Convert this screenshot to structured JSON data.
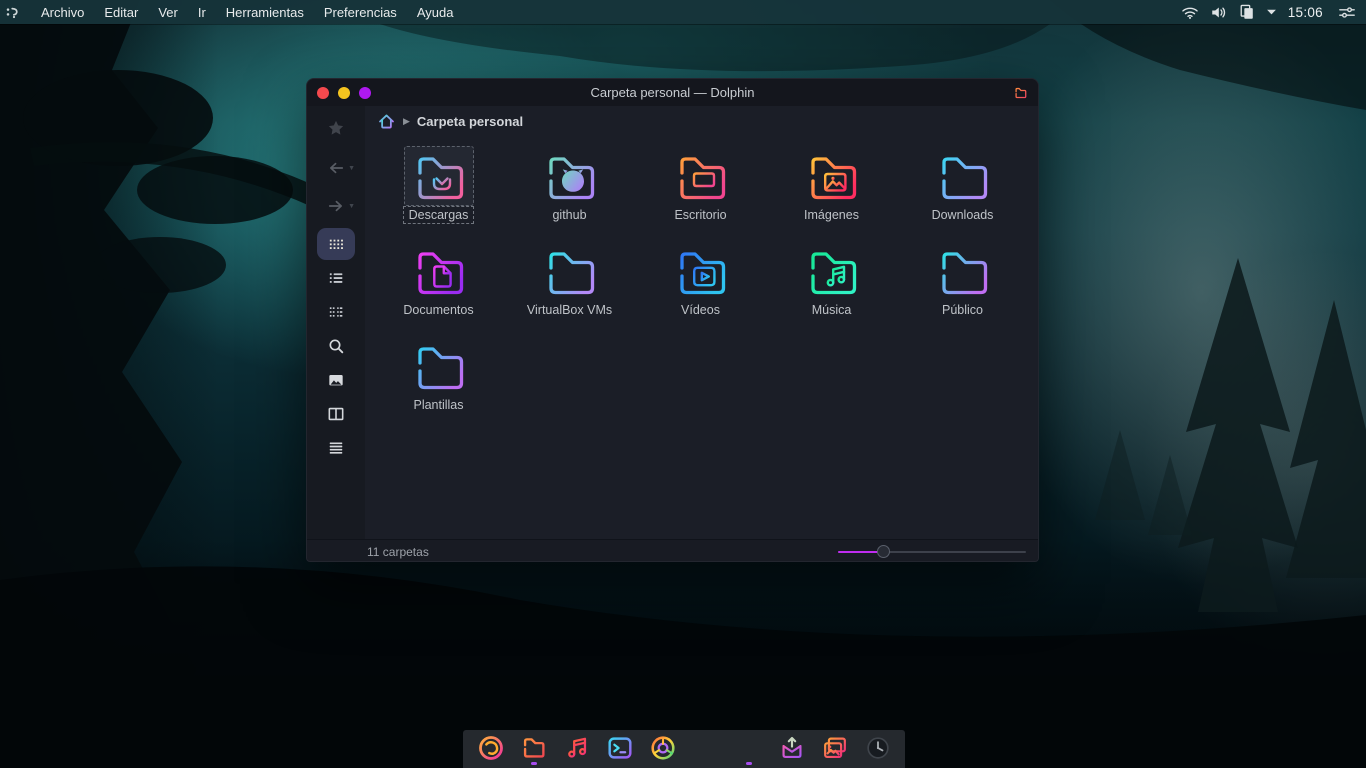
{
  "menubar": {
    "logo_icon": "distro-logo-icon",
    "items": [
      {
        "id": "archivo",
        "label": "Archivo"
      },
      {
        "id": "editar",
        "label": "Editar"
      },
      {
        "id": "ver",
        "label": "Ver"
      },
      {
        "id": "ir",
        "label": "Ir"
      },
      {
        "id": "herramientas",
        "label": "Herramientas"
      },
      {
        "id": "preferencias",
        "label": "Preferencias"
      },
      {
        "id": "ayuda",
        "label": "Ayuda"
      }
    ],
    "tray": {
      "icons_left": [
        {
          "id": "wifi",
          "name": "wifi-icon"
        },
        {
          "id": "volume",
          "name": "volume-icon"
        },
        {
          "id": "clipboard",
          "name": "clipboard-icon"
        },
        {
          "id": "caret",
          "name": "caret-down-icon"
        }
      ],
      "clock": "15:06",
      "icons_right": [
        {
          "id": "tune",
          "name": "tune-sliders-icon"
        }
      ]
    }
  },
  "window": {
    "title": "Carpeta personal — Dolphin",
    "titlebar_app_icon": "folder-icon",
    "breadcrumb": {
      "home_icon": "home-icon",
      "current": "Carpeta personal"
    },
    "sidebar": {
      "items": [
        {
          "id": "favorites",
          "icon": "star-icon",
          "state": "dim"
        },
        {
          "id": "back",
          "icon": "arrow-left-icon",
          "state": "dim",
          "has_caret": true
        },
        {
          "id": "forward",
          "icon": "arrow-right-icon",
          "state": "dim",
          "has_caret": true
        },
        {
          "id": "icons-view",
          "icon": "grid-view-icon",
          "state": "active"
        },
        {
          "id": "list-view",
          "icon": "list-view-icon"
        },
        {
          "id": "compact-view",
          "icon": "compact-view-icon"
        },
        {
          "id": "search",
          "icon": "search-icon"
        },
        {
          "id": "preview",
          "icon": "image-preview-icon"
        },
        {
          "id": "split-view",
          "icon": "split-view-icon"
        },
        {
          "id": "menu",
          "icon": "hamburger-menu-icon"
        }
      ]
    },
    "folders": [
      {
        "name": "Descargas",
        "emblem": "download",
        "color1": "#53c6f2",
        "color2": "#f2609e",
        "selected": true
      },
      {
        "name": "github",
        "emblem": "github",
        "color1": "#6fd8c0",
        "color2": "#ab84f5",
        "selected": false
      },
      {
        "name": "Escritorio",
        "emblem": "monitor",
        "color1": "#ff9d3c",
        "color2": "#f2458f",
        "selected": false
      },
      {
        "name": "Imágenes",
        "emblem": "image",
        "color1": "#ffc13a",
        "color2": "#ff2d60",
        "selected": false
      },
      {
        "name": "Downloads",
        "emblem": "none",
        "color1": "#3ed4f2",
        "color2": "#b389f7",
        "selected": false
      },
      {
        "name": "Documentos",
        "emblem": "document",
        "color1": "#ed3ff2",
        "color2": "#9a2cf2",
        "selected": false
      },
      {
        "name": "VirtualBox VMs",
        "emblem": "none",
        "color1": "#30e0e6",
        "color2": "#b389f7",
        "selected": false
      },
      {
        "name": "Vídeos",
        "emblem": "play",
        "color1": "#2f78f5",
        "color2": "#2fc4f0",
        "selected": false
      },
      {
        "name": "Música",
        "emblem": "music",
        "color1": "#17e896",
        "color2": "#2ff2c4",
        "selected": false
      },
      {
        "name": "Público",
        "emblem": "none",
        "color1": "#30e0e6",
        "color2": "#c06ef2",
        "selected": false
      },
      {
        "name": "Plantillas",
        "emblem": "none",
        "color1": "#33ccf2",
        "color2": "#bd6ef2",
        "selected": false
      }
    ],
    "statusbar": {
      "text": "11 carpetas",
      "slider_fill_color": "#bf2cf0",
      "slider_value_pct": 24
    }
  },
  "dock": {
    "items": [
      {
        "id": "firefox",
        "name": "firefox-icon",
        "running": false
      },
      {
        "id": "files",
        "name": "file-manager-icon",
        "running": true
      },
      {
        "id": "music",
        "name": "music-app-icon",
        "running": false
      },
      {
        "id": "terminal",
        "name": "terminal-icon",
        "running": false
      },
      {
        "id": "chrome",
        "name": "chrome-icon",
        "running": false
      },
      {
        "id": "vscode",
        "name": "vscode-icon",
        "running": false
      },
      {
        "id": "settings",
        "name": "settings-gear-icon",
        "running": true
      },
      {
        "id": "mail",
        "name": "mail-send-icon",
        "running": false
      },
      {
        "id": "photos",
        "name": "photos-icon",
        "running": false
      },
      {
        "id": "clock",
        "name": "clock-icon",
        "running": false
      }
    ]
  }
}
